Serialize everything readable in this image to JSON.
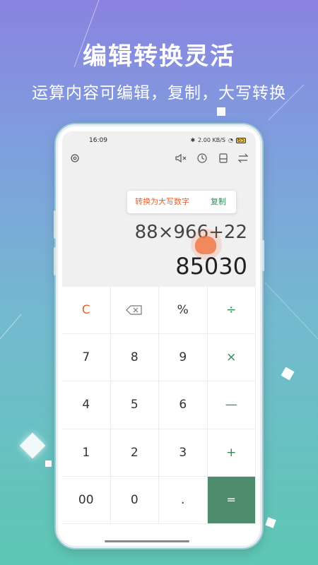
{
  "promo": {
    "headline": "编辑转换灵活",
    "subline": "运算内容可编辑，复制，大写转换"
  },
  "status_bar": {
    "time": "16:09",
    "speed": "2.00 KB/S",
    "battery": "65"
  },
  "toolbar": {
    "settings_icon": "gear-icon",
    "mute_icon": "mute-icon",
    "history_icon": "history-icon",
    "save_icon": "save-icon",
    "swap_icon": "swap-icon"
  },
  "popup": {
    "convert_label": "转换为大写数字",
    "copy_label": "复制"
  },
  "display": {
    "expression": "88×966+22",
    "result": "85030"
  },
  "keypad": {
    "keys": [
      "C",
      "⌫",
      "%",
      "÷",
      "7",
      "8",
      "9",
      "×",
      "4",
      "5",
      "6",
      "—",
      "1",
      "2",
      "3",
      "+",
      "00",
      "0",
      ".",
      "="
    ]
  },
  "colors": {
    "accent_green": "#4e8c6d",
    "accent_orange": "#e8612c"
  }
}
